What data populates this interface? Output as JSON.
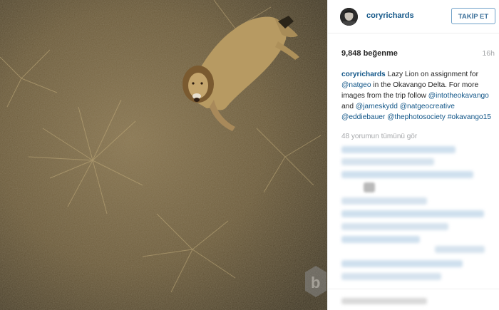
{
  "post": {
    "username": "coryrichards",
    "follow_label": "TAKİP ET",
    "likes": "9,848 beğenme",
    "time": "16h",
    "caption": {
      "username": "coryrichards",
      "t1": " Lazy Lion on assignment for ",
      "m1": "@natgeo",
      "t2": " in the Okavango Delta. For more images from the trip follow ",
      "m2": "@intotheokavango",
      "t3": " and ",
      "m3": "@jameskydd",
      "m4": "@natgeocreative",
      "m5": "@eddiebauer",
      "m6": "@thephotosociety",
      "m7": "#okavango15"
    },
    "view_comments": "48 yorumun tümünü gör"
  },
  "colors": {
    "accent": "#125688",
    "follow_border": "#6fa0c8",
    "muted": "#a5a7aa"
  },
  "icons": {
    "watermark": "b-logo-icon"
  }
}
